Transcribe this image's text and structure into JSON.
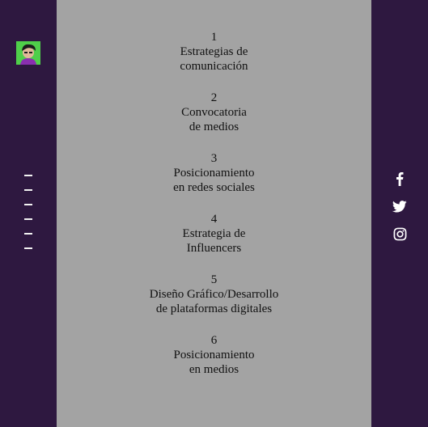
{
  "colors": {
    "side_bg": "#2e1840",
    "main_bg": "#a3a3a3",
    "avatar_bg": "#4fcf4a",
    "text": "#111111",
    "icon": "#ffffff"
  },
  "sidebar": {
    "avatar_icon": "avatar-icon",
    "section_markers": 6
  },
  "services": [
    {
      "number": "1",
      "line1": "Estrategias de",
      "line2": "comunicación"
    },
    {
      "number": "2",
      "line1": "Convocatoria",
      "line2": "de medios"
    },
    {
      "number": "3",
      "line1": "Posicionamiento",
      "line2": "en redes sociales"
    },
    {
      "number": "4",
      "line1": "Estrategia de",
      "line2": "Influencers"
    },
    {
      "number": "5",
      "line1": "Diseño Gráfico/Desarrollo",
      "line2": "de plataformas digitales"
    },
    {
      "number": "6",
      "line1": "Posicionamiento",
      "line2": "en medios"
    }
  ],
  "social": [
    {
      "icon": "facebook-icon"
    },
    {
      "icon": "twitter-icon"
    },
    {
      "icon": "instagram-icon"
    }
  ]
}
